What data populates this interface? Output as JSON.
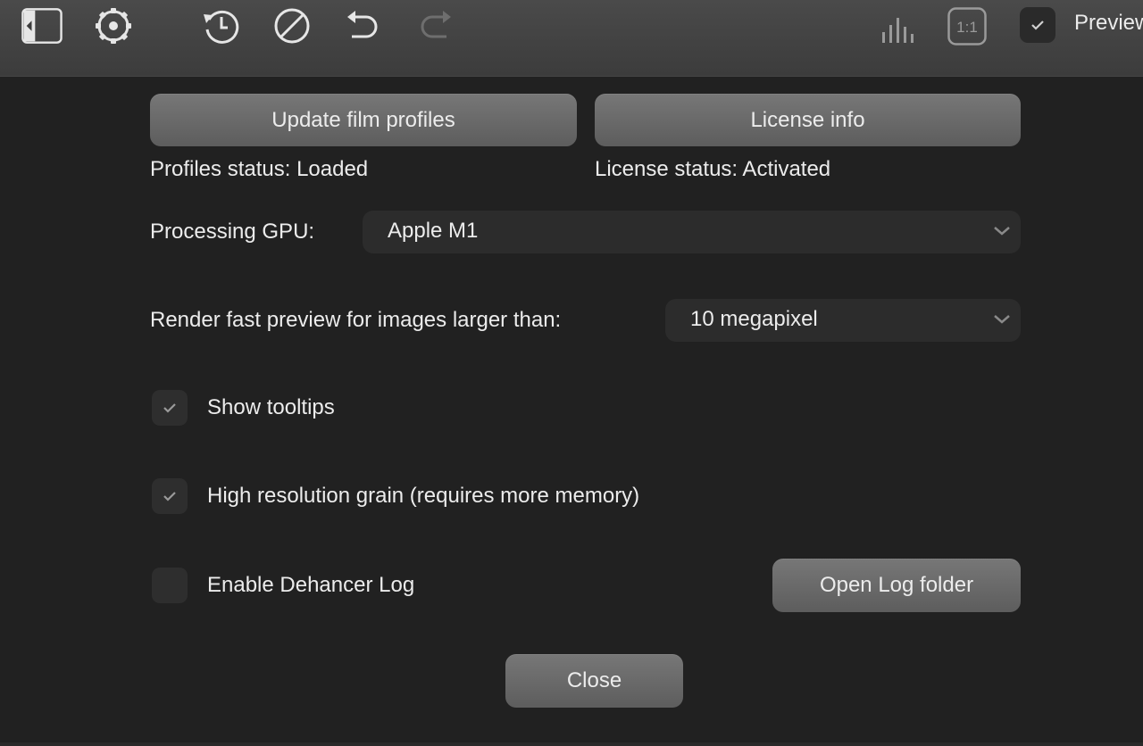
{
  "toolbar": {
    "icons": [
      {
        "name": "sidebar-toggle-icon"
      },
      {
        "name": "settings-icon"
      },
      {
        "name": "history-icon"
      },
      {
        "name": "reset-icon"
      },
      {
        "name": "undo-icon"
      },
      {
        "name": "redo-icon",
        "disabled": true
      },
      {
        "name": "histogram-icon"
      },
      {
        "name": "zoom-1to1-icon",
        "text": "1:1"
      }
    ],
    "preview": {
      "label": "Preview",
      "checked": true
    }
  },
  "settings": {
    "update_profiles_button": "Update film profiles",
    "license_info_button": "License info",
    "profiles_status": "Profiles status: Loaded",
    "license_status": "License status: Activated",
    "gpu": {
      "label": "Processing GPU:",
      "value": "Apple M1"
    },
    "fast_preview": {
      "label": "Render fast preview for images larger than:",
      "value": "10 megapixel"
    },
    "show_tooltips": {
      "label": "Show tooltips",
      "checked": true
    },
    "high_res_grain": {
      "label": "High resolution grain (requires more memory)",
      "checked": true
    },
    "dehancer_log": {
      "label": "Enable Dehancer Log",
      "checked": false
    },
    "open_log_button": "Open Log folder",
    "close_button": "Close"
  },
  "colors": {
    "background": "#212121",
    "toolbar": "#424242",
    "button": "#6a6a6a",
    "text": "#ececec",
    "disabled_icon": "#6e6e6e"
  }
}
